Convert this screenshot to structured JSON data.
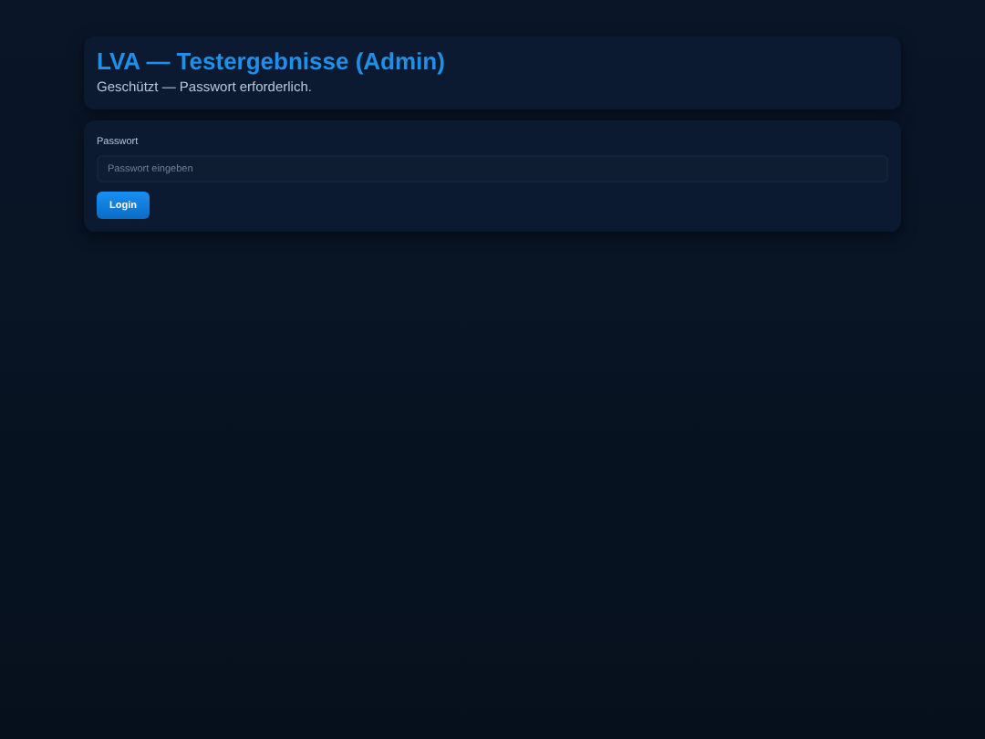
{
  "header": {
    "title": "LVA — Testergebnisse (Admin)",
    "subtitle": "Geschützt — Passwort erforderlich."
  },
  "login": {
    "label": "Passwort",
    "placeholder": "Passwort eingeben",
    "button": "Login"
  }
}
